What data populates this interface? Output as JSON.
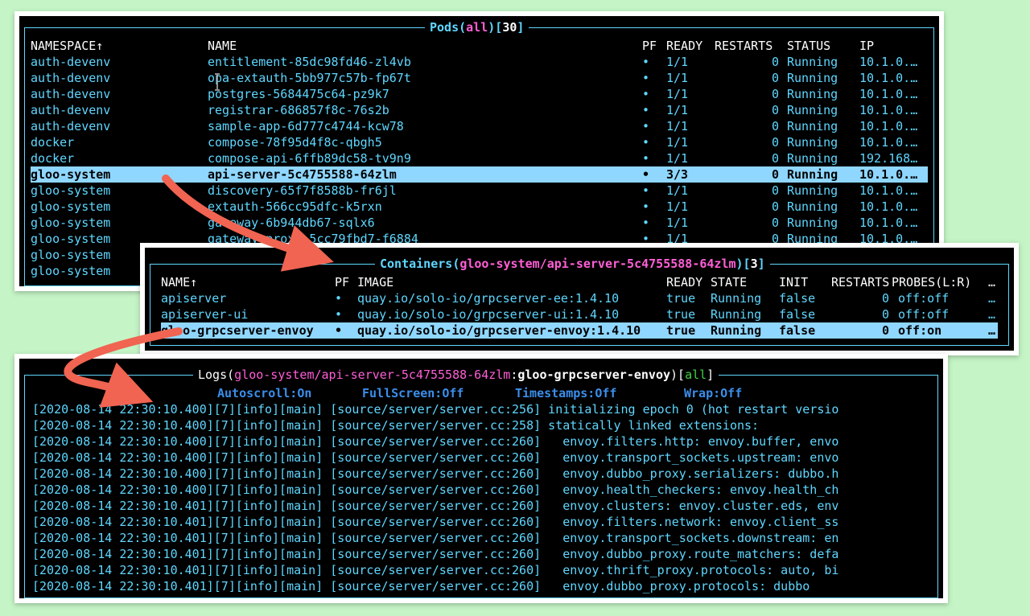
{
  "pods": {
    "title": "Pods",
    "scope": "all",
    "count": "30",
    "headers": {
      "namespace": "NAMESPACE↑",
      "name": "NAME",
      "pf": "PF",
      "ready": "READY",
      "restarts": "RESTARTS",
      "status": "STATUS",
      "ip": "IP"
    },
    "rows": [
      {
        "namespace": "auth-devenv",
        "name": "entitlement-85dc98fd46-zl4vb",
        "pf": "•",
        "ready": "1/1",
        "restarts": "0",
        "status": "Running",
        "ip": "10.1.0.…"
      },
      {
        "namespace": "auth-devenv",
        "name": "opa-extauth-5bb977c57b-fp67t",
        "pf": "•",
        "ready": "1/1",
        "restarts": "0",
        "status": "Running",
        "ip": "10.1.0.…"
      },
      {
        "namespace": "auth-devenv",
        "name": "postgres-5684475c64-pz9k7",
        "pf": "•",
        "ready": "1/1",
        "restarts": "0",
        "status": "Running",
        "ip": "10.1.0.…"
      },
      {
        "namespace": "auth-devenv",
        "name": "registrar-686857f8c-76s2b",
        "pf": "•",
        "ready": "1/1",
        "restarts": "0",
        "status": "Running",
        "ip": "10.1.0.…"
      },
      {
        "namespace": "auth-devenv",
        "name": "sample-app-6d777c4744-kcw78",
        "pf": "•",
        "ready": "1/1",
        "restarts": "0",
        "status": "Running",
        "ip": "10.1.0.…"
      },
      {
        "namespace": "docker",
        "name": "compose-78f95d4f8c-qbgh5",
        "pf": "•",
        "ready": "1/1",
        "restarts": "0",
        "status": "Running",
        "ip": "10.1.0.…"
      },
      {
        "namespace": "docker",
        "name": "compose-api-6ffb89dc58-tv9n9",
        "pf": "•",
        "ready": "1/1",
        "restarts": "0",
        "status": "Running",
        "ip": "192.168…"
      },
      {
        "namespace": "gloo-system",
        "name": "api-server-5c4755588-64zlm",
        "pf": "•",
        "ready": "3/3",
        "restarts": "0",
        "status": "Running",
        "ip": "10.1.0.…",
        "selected": true
      },
      {
        "namespace": "gloo-system",
        "name": "discovery-65f7f8588b-fr6jl",
        "pf": "•",
        "ready": "1/1",
        "restarts": "0",
        "status": "Running",
        "ip": "10.1.0.…"
      },
      {
        "namespace": "gloo-system",
        "name": "extauth-566cc95dfc-k5rxn",
        "pf": "•",
        "ready": "1/1",
        "restarts": "0",
        "status": "Running",
        "ip": "10.1.0.…"
      },
      {
        "namespace": "gloo-system",
        "name": "gateway-6b944db67-sqlx6",
        "pf": "•",
        "ready": "1/1",
        "restarts": "0",
        "status": "Running",
        "ip": "10.1.0.…"
      },
      {
        "namespace": "gloo-system",
        "name": "gateway-proxy-5cc79fbd7-f6884",
        "pf": "•",
        "ready": "1/1",
        "restarts": "0",
        "status": "Running",
        "ip": "10.1.0.…"
      },
      {
        "namespace": "gloo-system",
        "name": "",
        "pf": "",
        "ready": "",
        "restarts": "",
        "status": "",
        "ip": ""
      },
      {
        "namespace": "gloo-system",
        "name": "",
        "pf": "",
        "ready": "",
        "restarts": "",
        "status": "",
        "ip": ""
      }
    ]
  },
  "containers": {
    "title": "Containers",
    "path": "gloo-system/api-server-5c4755588-64zlm",
    "count": "3",
    "headers": {
      "name": "NAME↑",
      "pf": "PF",
      "image": "IMAGE",
      "ready": "READY",
      "state": "STATE",
      "init": "INIT",
      "restarts": "RESTARTS",
      "probes": "PROBES(L:R)",
      "more": "…"
    },
    "rows": [
      {
        "name": "apiserver",
        "pf": "•",
        "image": "quay.io/solo-io/grpcserver-ee:1.4.10",
        "ready": "true",
        "state": "Running",
        "init": "false",
        "restarts": "0",
        "probes": "off:off",
        "more": "…"
      },
      {
        "name": "apiserver-ui",
        "pf": "•",
        "image": "quay.io/solo-io/grpcserver-ui:1.4.10",
        "ready": "true",
        "state": "Running",
        "init": "false",
        "restarts": "0",
        "probes": "off:off",
        "more": "…"
      },
      {
        "name": "gloo-grpcserver-envoy",
        "pf": "•",
        "image": "quay.io/solo-io/grpcserver-envoy:1.4.10",
        "ready": "true",
        "state": "Running",
        "init": "false",
        "restarts": "0",
        "probes": "off:on",
        "more": "…",
        "selected": true
      }
    ]
  },
  "logs": {
    "title": "Logs",
    "path": "gloo-system/api-server-5c4755588-64zlm",
    "container": "gloo-grpcserver-envoy",
    "scope": "all",
    "toggles": [
      "Autoscroll:On",
      "FullScreen:Off",
      "Timestamps:Off",
      "Wrap:Off"
    ],
    "lines": [
      "[2020-08-14 22:30:10.400][7][info][main] [source/server/server.cc:256] initializing epoch 0 (hot restart versio",
      "[2020-08-14 22:30:10.400][7][info][main] [source/server/server.cc:258] statically linked extensions:",
      "[2020-08-14 22:30:10.400][7][info][main] [source/server/server.cc:260]   envoy.filters.http: envoy.buffer, envo",
      "[2020-08-14 22:30:10.400][7][info][main] [source/server/server.cc:260]   envoy.transport_sockets.upstream: envo",
      "[2020-08-14 22:30:10.400][7][info][main] [source/server/server.cc:260]   envoy.dubbo_proxy.serializers: dubbo.h",
      "[2020-08-14 22:30:10.400][7][info][main] [source/server/server.cc:260]   envoy.health_checkers: envoy.health_ch",
      "[2020-08-14 22:30:10.401][7][info][main] [source/server/server.cc:260]   envoy.clusters: envoy.cluster.eds, env",
      "[2020-08-14 22:30:10.401][7][info][main] [source/server/server.cc:260]   envoy.filters.network: envoy.client_ss",
      "[2020-08-14 22:30:10.401][7][info][main] [source/server/server.cc:260]   envoy.transport_sockets.downstream: en",
      "[2020-08-14 22:30:10.401][7][info][main] [source/server/server.cc:260]   envoy.dubbo_proxy.route_matchers: defa",
      "[2020-08-14 22:30:10.401][7][info][main] [source/server/server.cc:260]   envoy.thrift_proxy.protocols: auto, bi",
      "[2020-08-14 22:30:10.401][7][info][main] [source/server/server.cc:260]   envoy.dubbo_proxy.protocols: dubbo"
    ]
  },
  "colors": {
    "accent": "#5fd7ff",
    "selection": "#8fd7ff",
    "magenta": "#ff5fd7",
    "green": "#44d144",
    "toggle": "#3b8eea",
    "arrow": "#f06451",
    "background": "#c5f5c6"
  }
}
